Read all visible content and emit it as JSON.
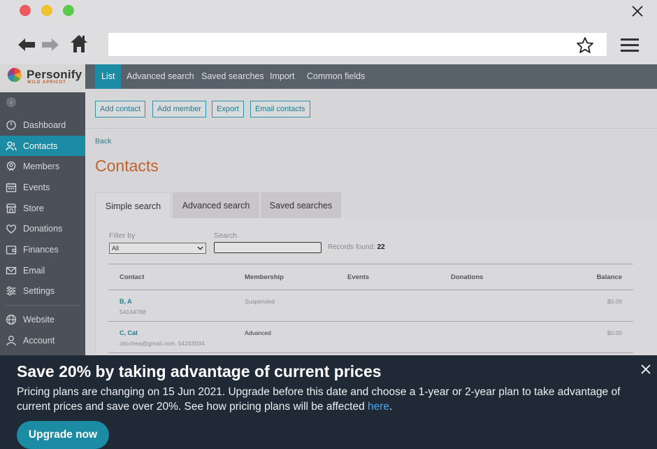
{
  "sidebar": {
    "brand_name": "Personify",
    "brand_sub": "WILD APRICOT",
    "collapse_glyph": "‹",
    "items": [
      {
        "label": "Dashboard",
        "icon": "dashboard-icon"
      },
      {
        "label": "Contacts",
        "icon": "contacts-icon",
        "active": true
      },
      {
        "label": "Members",
        "icon": "members-icon"
      },
      {
        "label": "Events",
        "icon": "events-icon"
      },
      {
        "label": "Store",
        "icon": "store-icon"
      },
      {
        "label": "Donations",
        "icon": "heart-icon"
      },
      {
        "label": "Finances",
        "icon": "wallet-icon"
      },
      {
        "label": "Email",
        "icon": "mail-icon"
      },
      {
        "label": "Settings",
        "icon": "sliders-icon"
      }
    ],
    "bottom_items": [
      {
        "label": "Website",
        "icon": "globe-icon"
      },
      {
        "label": "Account",
        "icon": "account-icon"
      }
    ]
  },
  "topnav": {
    "tabs": [
      {
        "label": "List",
        "active": true
      },
      {
        "label": "Advanced search"
      },
      {
        "label": "Saved searches"
      },
      {
        "label": "Import"
      },
      {
        "label": "Common fields"
      }
    ]
  },
  "actions": {
    "add_contact": "Add contact",
    "add_member": "Add member",
    "export": "Export",
    "email_contacts": "Email contacts"
  },
  "page": {
    "back": "Back",
    "title": "Contacts"
  },
  "search_tabs": [
    {
      "label": "Simple search",
      "active": true
    },
    {
      "label": "Advanced search"
    },
    {
      "label": "Saved searches"
    }
  ],
  "filter": {
    "label": "Filter by",
    "value": "All",
    "search_label": "Search",
    "records_label": "Records found:",
    "records_count": "22"
  },
  "table": {
    "headers": [
      "Contact",
      "Membership",
      "Events",
      "Donations",
      "Balance"
    ],
    "rows": [
      {
        "name": "B, A",
        "sub": "54144788",
        "membership": "Suspended",
        "events": "",
        "donations": "",
        "balance": "$0.00"
      },
      {
        "name": "C, Cat",
        "sub": "cbcchea@gmail.com, 54243034",
        "membership": "Advanced",
        "events": "",
        "donations": "",
        "balance": "$0.00"
      }
    ]
  },
  "banner": {
    "title": "Save 20% by taking advantage of current prices",
    "text": "Pricing plans are changing on 15 Jun 2021. Upgrade before this date and choose a 1-year or 2-year plan to take advantage of current prices and save over 20%. See how pricing plans will be affected ",
    "link": "here",
    "link_suffix": ".",
    "button": "Upgrade now"
  },
  "colors": {
    "accent": "#1b8ca4",
    "title_orange": "#c2612e",
    "sidebar_bg": "#4c5159",
    "banner_bg": "#202a37",
    "link_blue": "#47a8f0"
  }
}
